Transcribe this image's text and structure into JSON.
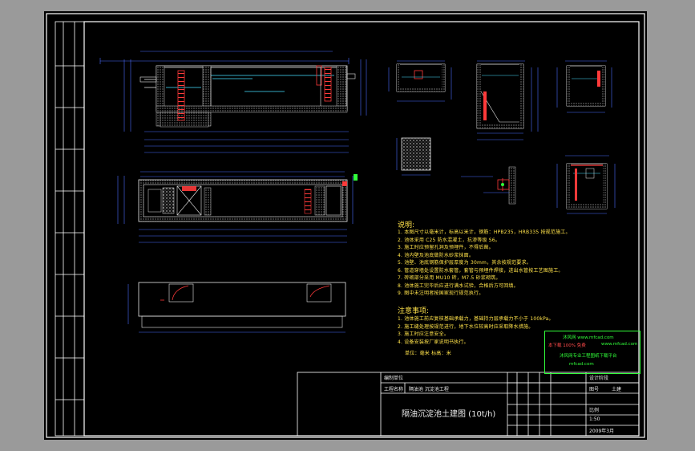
{
  "title_block": {
    "drawing_title": "隔油沉淀池土建图 (10t/h)",
    "row_label": "编制单位",
    "project_label": "工程名称",
    "project_name": "隔油池 沉淀池工程",
    "field_1": "设计阶段",
    "field_2": "图号",
    "field_3": "比例",
    "scale": "1:50",
    "field_4": "日期",
    "sheet_value": "土建",
    "date": "2009年3月"
  },
  "notes": {
    "title": "说明:",
    "items": [
      "1. 本图尺寸以毫米计，标高以米计，钢筋：HPB235，HRB335 按规范施工。",
      "2. 池体采用 C25 防水混凝土，抗渗等级 S6。",
      "3. 施工时应预留孔洞及预埋件，不得后凿。",
      "4. 池内壁及池底做防水砂浆抹面。",
      "5. 池壁、池底钢筋保护层厚度为 30mm，其余按规范要求。",
      "6. 管道穿墙处设置防水套管，套管与预埋件焊接，进出水管按工艺图施工。",
      "7. 砖砌部分采用 MU10 砖，M7.5 砂浆砌筑。",
      "8. 池体施工完毕后应进行满水试验，合格后方可回填。",
      "9. 图中未注明者按国家现行规范执行。"
    ]
  },
  "attention": {
    "title": "注意事项:",
    "items": [
      "1. 池体施工前应复核基础承载力，基础持力层承载力不小于 100kPa。",
      "2. 施工缝处理按规范进行，地下水位较高时应采取降水措施。",
      "3. 施工时应注意安全。",
      "4. 设备安装按厂家说明书执行。"
    ],
    "footer": "单位：毫米     标高：米"
  },
  "stamp": {
    "line1": "沐风网  www.mfcad.com",
    "line2": "本下载 100% 免费",
    "line3": "www.mfcad.com",
    "line4": "沐风网专业工程图纸下载平台",
    "line5": "mfcad.com"
  },
  "left_strip": {
    "cells": [
      "",
      "",
      "",
      "",
      "",
      "",
      "",
      "",
      "",
      ""
    ]
  },
  "colors": {
    "sheet": "#000000",
    "frame": "#ffffff",
    "line": "#e8e8e8",
    "water": "#46e0ff",
    "ladder": "#ff3a3a",
    "notes": "#ffe24a",
    "stamp": "#31ff3a",
    "dimension": "#4a6cff",
    "hatch": "#c8c8c8"
  }
}
